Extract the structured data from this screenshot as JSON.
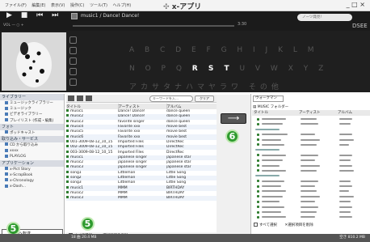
{
  "menubar": {
    "items": [
      "ファイル(F)",
      "編集(E)",
      "表示(V)",
      "操作(C)",
      "ツール(T)",
      "ヘルプ(H)"
    ],
    "app_title": "x-アプリ",
    "window_controls": "_ □ ×"
  },
  "player": {
    "transport": "▶ ■ ⏮ ⏭",
    "volume_label": "VOL — ○ +",
    "track": "music1 / Dance! Dance!",
    "search_placeholder": "ノーツ発見!",
    "time_position": "3:30",
    "brand": "DSEE"
  },
  "alphabet": {
    "row1": "A B C D E F G H I J K L M",
    "row2_pre": "N O P Q ",
    "row2_hi": "R S T",
    "row2_post": " U V W X Y Z",
    "row3": "アカサタナハマヤラワ その他"
  },
  "sidebar": {
    "library_header": "ライブラリー",
    "library_items": [
      "ミュージックライブラリー",
      "ミュージック",
      "ビデオライブラリー",
      "プレイリスト (作成・編集)",
      "ポッドキャスト"
    ],
    "photo_header": "フォト",
    "photo_items": [
      "ポッドキャスト"
    ],
    "services_header": "取り込み・サービス",
    "services_items": [
      "CD から取り込み",
      "xxxx",
      "PLAYLOG"
    ],
    "apps_header": "アプリケーション",
    "apps_items": [
      "x-Pict Story",
      "x-ScrapBook",
      "x-Chronology",
      "x-Dash..."
    ],
    "transfer_label": "機器へ転送"
  },
  "library": {
    "search_placeholder": "キーワードを入…",
    "clear_label": "クリア",
    "columns": [
      "タイトル",
      "アーティスト",
      "アルバム"
    ],
    "rows": [
      [
        "music1",
        "Dance! Dance!",
        "dance queen"
      ],
      [
        "music2",
        "Dance! Dance!",
        "dance queen"
      ],
      [
        "music3",
        "favorite singer",
        "dance queen"
      ],
      [
        "music4",
        "Favorite xxx",
        "movie best"
      ],
      [
        "music5",
        "Favorite xxx",
        "movie best"
      ],
      [
        "music6",
        "Favorite xxx",
        "movie best"
      ],
      [
        "001-3009-08-12_10_15",
        "Imported Files",
        "DirectRec"
      ],
      [
        "002-3009-08-12_10_15",
        "Imported Files",
        "DirectRec"
      ],
      [
        "003-3009-08-12_10_15",
        "Imported Files",
        "DirectRec"
      ],
      [
        "music1",
        "japanese singer",
        "japanese star"
      ],
      [
        "music2",
        "japanese singer",
        "japanese star"
      ],
      [
        "music3",
        "japanese singer",
        "japanese star"
      ],
      [
        "song1",
        "Littleman",
        "Little Song"
      ],
      [
        "song2",
        "Littleman",
        "Little Song"
      ],
      [
        "song3",
        "Littleman",
        "Little Song"
      ],
      [
        "music1",
        "MMM",
        "BIRTHDAY"
      ],
      [
        "music2",
        "MMM",
        "BIRTHDAY"
      ],
      [
        "music3",
        "MMM",
        "BIRTHDAY"
      ]
    ],
    "select_all": "すべて選択",
    "remove_selected": "選択項目を削除"
  },
  "device": {
    "selector": "ウォークマン",
    "folder_title": "MUSIC フォルダー",
    "columns": [
      "タイトル",
      "アーティスト",
      "アルバム"
    ],
    "select_all": "すべて選択",
    "remove_selected": "選択項目を削除"
  },
  "transfer_arrow": "⟶",
  "status": {
    "left": "18 曲 20.4 MB",
    "right": "空き 810.2 MB"
  },
  "callouts": [
    "5",
    "6"
  ]
}
